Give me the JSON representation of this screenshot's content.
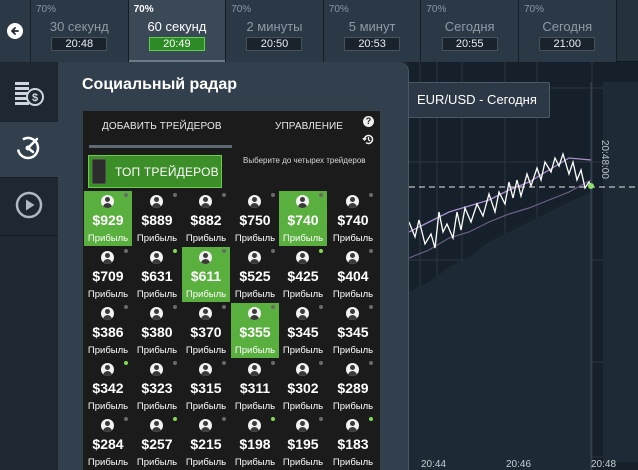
{
  "topbar": {
    "back_icon": "arrow-left-icon",
    "tabs": [
      {
        "pct": "70%",
        "label": "30 секунд",
        "time": "20:48",
        "active": false
      },
      {
        "pct": "70%",
        "label": "60 секунд",
        "time": "20:49",
        "active": true
      },
      {
        "pct": "70%",
        "label": "2 минуты",
        "time": "20:50",
        "active": false
      },
      {
        "pct": "70%",
        "label": "5 минут",
        "time": "20:53",
        "active": false
      },
      {
        "pct": "70%",
        "label": "Сегодня",
        "time": "20:55",
        "active": false
      },
      {
        "pct": "70%",
        "label": "Сегодня",
        "time": "21:00",
        "active": false
      }
    ]
  },
  "leftbar": {
    "items": [
      {
        "icon": "coins-icon"
      },
      {
        "icon": "radar-icon",
        "active": true
      },
      {
        "icon": "play-icon"
      }
    ]
  },
  "panel": {
    "title": "Социальный радар",
    "tab_add": "ДОБАВИТЬ ТРЕЙДЕРОВ",
    "tab_manage": "УПРАВЛЕНИЕ",
    "help": "?",
    "hint": "Выберите до четырех трейдеров",
    "top_button": "ТОП ТРЕЙДЕРОВ",
    "profit_label": "Прибыль",
    "traders": [
      {
        "amount": "$929",
        "selected": true,
        "online": false
      },
      {
        "amount": "$889",
        "selected": false,
        "online": false
      },
      {
        "amount": "$882",
        "selected": false,
        "online": false
      },
      {
        "amount": "$750",
        "selected": false,
        "online": false
      },
      {
        "amount": "$740",
        "selected": true,
        "online": false
      },
      {
        "amount": "$740",
        "selected": false,
        "online": false
      },
      {
        "amount": "$709",
        "selected": false,
        "online": false
      },
      {
        "amount": "$631",
        "selected": false,
        "online": true
      },
      {
        "amount": "$611",
        "selected": true,
        "online": false
      },
      {
        "amount": "$525",
        "selected": false,
        "online": false
      },
      {
        "amount": "$425",
        "selected": false,
        "online": true
      },
      {
        "amount": "$404",
        "selected": false,
        "online": false
      },
      {
        "amount": "$386",
        "selected": false,
        "online": false
      },
      {
        "amount": "$380",
        "selected": false,
        "online": false
      },
      {
        "amount": "$370",
        "selected": false,
        "online": false
      },
      {
        "amount": "$355",
        "selected": true,
        "online": false
      },
      {
        "amount": "$345",
        "selected": false,
        "online": false
      },
      {
        "amount": "$345",
        "selected": false,
        "online": false
      },
      {
        "amount": "$342",
        "selected": false,
        "online": true
      },
      {
        "amount": "$323",
        "selected": false,
        "online": false
      },
      {
        "amount": "$315",
        "selected": false,
        "online": false
      },
      {
        "amount": "$311",
        "selected": false,
        "online": false
      },
      {
        "amount": "$302",
        "selected": false,
        "online": false
      },
      {
        "amount": "$289",
        "selected": false,
        "online": false
      },
      {
        "amount": "$284",
        "selected": false,
        "online": false
      },
      {
        "amount": "$257",
        "selected": false,
        "online": true
      },
      {
        "amount": "$215",
        "selected": false,
        "online": false
      },
      {
        "amount": "$198",
        "selected": false,
        "online": true
      },
      {
        "amount": "$195",
        "selected": false,
        "online": false
      },
      {
        "amount": "$183",
        "selected": false,
        "online": true
      }
    ]
  },
  "chart": {
    "pair_label": "EUR/USD - Сегодня",
    "expiry_time": "20:48:00",
    "x_ticks": [
      "20:44",
      "20:46",
      "20:48"
    ],
    "price_color": "#ffffff",
    "band_color": "#a88fd0"
  }
}
